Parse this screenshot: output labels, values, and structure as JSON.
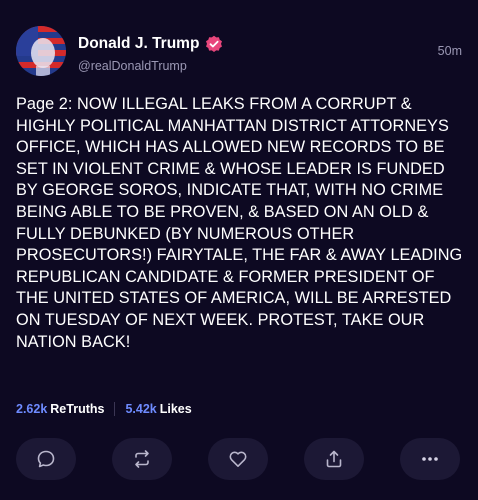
{
  "post": {
    "author_name": "Donald J. Trump",
    "handle": "@realDonaldTrump",
    "time_ago": "50m",
    "body": "Page 2: NOW ILLEGAL LEAKS FROM A CORRUPT & HIGHLY POLITICAL MANHATTAN DISTRICT ATTORNEYS OFFICE, WHICH HAS ALLOWED NEW RECORDS TO BE SET IN VIOLENT CRIME & WHOSE LEADER IS FUNDED BY GEORGE SOROS, INDICATE THAT, WITH NO CRIME BEING ABLE TO BE PROVEN, & BASED ON AN OLD & FULLY DEBUNKED (BY NUMEROUS OTHER PROSECUTORS!) FAIRYTALE, THE FAR & AWAY LEADING REPUBLICAN CANDIDATE & FORMER PRESIDENT OF THE UNITED STATES OF AMERICA, WILL BE ARRESTED ON TUESDAY OF NEXT WEEK. PROTEST, TAKE OUR NATION BACK!"
  },
  "stats": {
    "retruths_count": "2.62k",
    "retruths_label": "ReTruths",
    "likes_count": "5.42k",
    "likes_label": "Likes"
  },
  "actions": [
    {
      "icon": "reply-icon"
    },
    {
      "icon": "retruth-icon"
    },
    {
      "icon": "heart-icon"
    },
    {
      "icon": "share-icon"
    },
    {
      "icon": "more-icon"
    }
  ],
  "colors": {
    "background": "#0d0922",
    "accent": "#6e8bff",
    "verified_badge": "#e8467c",
    "muted_text": "#9b98b4",
    "button_bg": "#1c1835"
  }
}
